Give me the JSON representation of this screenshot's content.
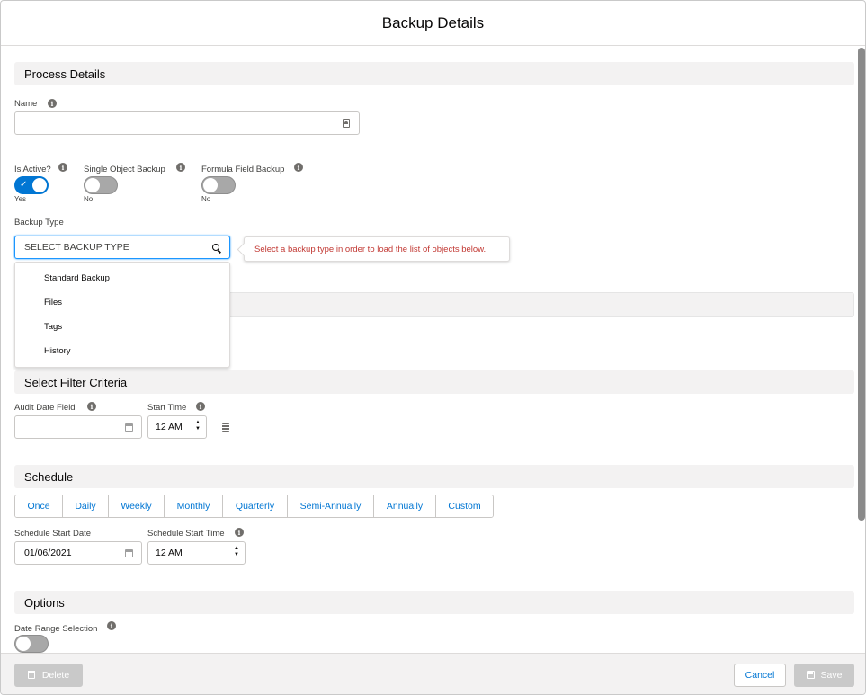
{
  "modal": {
    "title": "Backup Details"
  },
  "sections": {
    "process_details": "Process Details",
    "select_filter_criteria": "Select Filter Criteria",
    "schedule": "Schedule",
    "options": "Options"
  },
  "process": {
    "name_label": "Name",
    "name_value": "",
    "is_active": {
      "label": "Is Active?",
      "state": "Yes",
      "on": true
    },
    "single_object_backup": {
      "label": "Single Object Backup",
      "state": "No",
      "on": false
    },
    "formula_field_backup": {
      "label": "Formula Field Backup",
      "state": "No",
      "on": false
    },
    "backup_type_label": "Backup Type",
    "backup_type_placeholder": "SELECT BACKUP TYPE",
    "backup_type_options": [
      "Standard Backup",
      "Files",
      "Tags",
      "History"
    ],
    "backup_type_error": "Select a backup type in order to load the list of objects below."
  },
  "filter": {
    "audit_date_field_label": "Audit Date Field",
    "audit_date_field_value": "",
    "start_time_label": "Start Time",
    "start_time_value": "12 AM"
  },
  "schedule": {
    "frequencies": [
      "Once",
      "Daily",
      "Weekly",
      "Monthly",
      "Quarterly",
      "Semi-Annually",
      "Annually",
      "Custom"
    ],
    "start_date_label": "Schedule Start Date",
    "start_date_value": "01/06/2021",
    "start_time_label": "Schedule Start Time",
    "start_time_value": "12 AM"
  },
  "options": {
    "date_range_selection_label": "Date Range Selection",
    "date_range_selection_on": false
  },
  "footer": {
    "delete_label": "Delete",
    "cancel_label": "Cancel",
    "save_label": "Save"
  },
  "colors": {
    "brand": "#0176d3",
    "error": "#c23934",
    "section_bg": "#f3f2f2"
  }
}
